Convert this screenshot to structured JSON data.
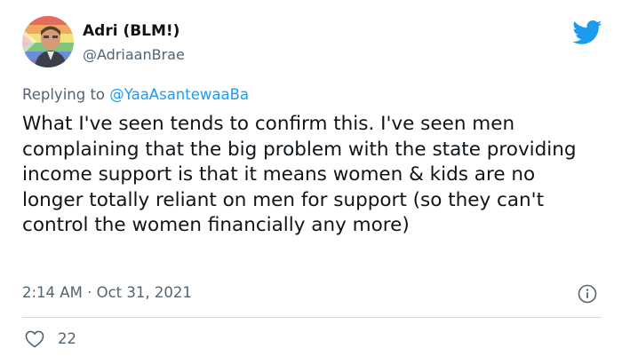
{
  "author": {
    "display_name": "Adri (BLM!)",
    "handle": "@AdriaanBrae"
  },
  "reply": {
    "prefix": "Replying to ",
    "mention": "@YaaAsantewaaBa"
  },
  "tweet": {
    "text": "What I've seen tends to confirm this. I've seen men complaining that the big problem with the state providing income support is that it means women & kids are no longer totally reliant on men for support (so they can't control the women financially any more)",
    "time": "2:14 AM",
    "separator": " · ",
    "date": "Oct 31, 2021"
  },
  "stats": {
    "likes": "22"
  },
  "icons": {
    "brand": "twitter-bird-icon",
    "info": "info-icon",
    "like": "heart-icon"
  },
  "colors": {
    "brand_blue": "#1d9bf0",
    "secondary_text": "#536471",
    "primary_text": "#0f1419",
    "divider": "#cfd9de"
  }
}
